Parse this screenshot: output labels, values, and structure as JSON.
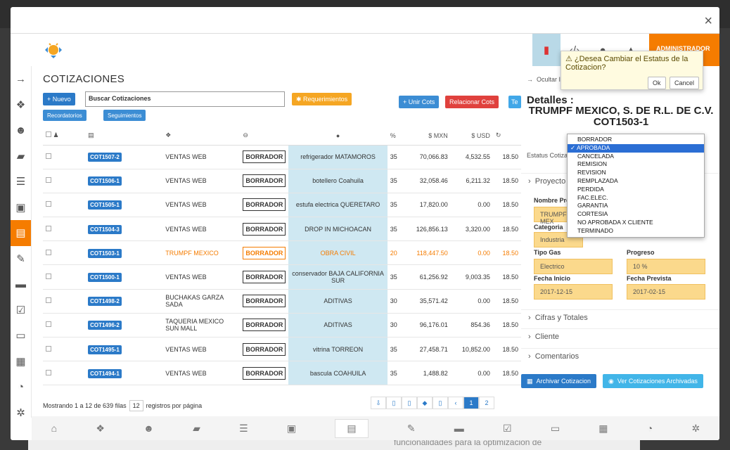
{
  "background": {
    "bottom_text": "funcionalidades para la optimización de"
  },
  "modal": {
    "close": "×"
  },
  "header": {
    "admin": "ADMINISTRADOR"
  },
  "main": {
    "title": "COTIZACIONES",
    "nuevo": "+ Nuevo",
    "search_placeholder": "Buscar Cotizaciones",
    "requerimientos": "✱ Requerimientos",
    "unir": "+ Unir Cots",
    "relacionar": "Relacionar Cots",
    "tab": "Te",
    "recordatorios": "Recordatorios",
    "seguimientos": "Seguimientos",
    "columns": [
      "%",
      "$ MXN",
      "$ USD"
    ],
    "rows": [
      {
        "code": "COT1507-2",
        "client": "VENTAS WEB",
        "status": "BORRADOR",
        "desc": "refrigerador MATAMOROS",
        "pct": "35",
        "mxn": "70,066.83",
        "usd": "4,532.55",
        "tc": "18.50"
      },
      {
        "code": "COT1506-1",
        "client": "VENTAS WEB",
        "status": "BORRADOR",
        "desc": "botellero Coahuila",
        "pct": "35",
        "mxn": "32,058.46",
        "usd": "6,211.32",
        "tc": "18.50"
      },
      {
        "code": "COT1505-1",
        "client": "VENTAS WEB",
        "status": "BORRADOR",
        "desc": "estufa electrica QUERETARO",
        "pct": "35",
        "mxn": "17,820.00",
        "usd": "0.00",
        "tc": "18.50"
      },
      {
        "code": "COT1504-3",
        "client": "VENTAS WEB",
        "status": "BORRADOR",
        "desc": "DROP IN MICHOACAN",
        "pct": "35",
        "mxn": "126,856.13",
        "usd": "3,320.00",
        "tc": "18.50"
      },
      {
        "code": "COT1503-1",
        "client": "TRUMPF MEXICO",
        "status": "BORRADOR",
        "desc": "OBRA CIVIL",
        "pct": "20",
        "mxn": "118,447.50",
        "usd": "0.00",
        "tc": "18.50"
      },
      {
        "code": "COT1500-1",
        "client": "VENTAS WEB",
        "status": "BORRADOR",
        "desc": "conservador BAJA CALIFORNIA SUR",
        "pct": "35",
        "mxn": "61,256.92",
        "usd": "9,003.35",
        "tc": "18.50"
      },
      {
        "code": "COT1498-2",
        "client": "BUCHAKAS GARZA SADA",
        "status": "BORRADOR",
        "desc": "ADITIVAS",
        "pct": "30",
        "mxn": "35,571.42",
        "usd": "0.00",
        "tc": "18.50"
      },
      {
        "code": "COT1496-2",
        "client": "TAQUERIA MEXICO SUN MALL",
        "status": "BORRADOR",
        "desc": "ADITIVAS",
        "pct": "30",
        "mxn": "96,176.01",
        "usd": "854.36",
        "tc": "18.50"
      },
      {
        "code": "COT1495-1",
        "client": "VENTAS WEB",
        "status": "BORRADOR",
        "desc": "vitrina TORREON",
        "pct": "35",
        "mxn": "27,458.71",
        "usd": "10,852.00",
        "tc": "18.50"
      },
      {
        "code": "COT1494-1",
        "client": "VENTAS WEB",
        "status": "BORRADOR",
        "desc": "bascula COAHUILA",
        "pct": "35",
        "mxn": "1,488.82",
        "usd": "0.00",
        "tc": "18.50"
      }
    ],
    "footer_showing": "Mostrando 1 a 12 de 639 filas",
    "page_size": "12",
    "footer_per_page": "registros por página",
    "pages": [
      "‹",
      "1",
      "2"
    ]
  },
  "panel": {
    "ocultar": "Ocultar Inf",
    "detalles": "Detalles :",
    "company": "TRUMPF MEXICO, S. DE R.L. DE C.V.",
    "cot": "COT1503-1",
    "estatus_label": "Estatus Cotizacion",
    "proyecto": "Proyecto",
    "nombre_label": "Nombre Proyecto",
    "nombre_value": "TRUMPF MEX",
    "categoria_label": "Categoria",
    "categoria_value": "Industria",
    "tipo_gas_label": "Tipo Gas",
    "tipo_gas_value": "Electrico",
    "progreso_label": "Progreso",
    "progreso_value": "10 %",
    "fecha_inicio_label": "Fecha Inicio",
    "fecha_inicio_value": "2017-12-15",
    "fecha_prevista_label": "Fecha Prevista",
    "fecha_prevista_value": "2017-02-15",
    "cifras": "Cifras y Totales",
    "cliente": "Cliente",
    "comentarios": "Comentarios",
    "archivar": "Archivar Cotizacion",
    "ver_archivadas": "Ver Cotizaciones Archivadas"
  },
  "dropdown": {
    "options": [
      "BORRADOR",
      "APROBADA",
      "CANCELADA",
      "REMISION",
      "REVISION",
      "REMPLAZADA",
      "PERDIDA",
      "FAC.ELEC.",
      "GARANTIA",
      "CORTESIA",
      "NO APROBADA X CLIENTE",
      "TERMINADO"
    ],
    "selected": "APROBADA"
  },
  "popover": {
    "question": "¿Desea Cambiar el Estatus de la Cotizacion?",
    "ok": "Ok",
    "cancel": "Cancel"
  }
}
